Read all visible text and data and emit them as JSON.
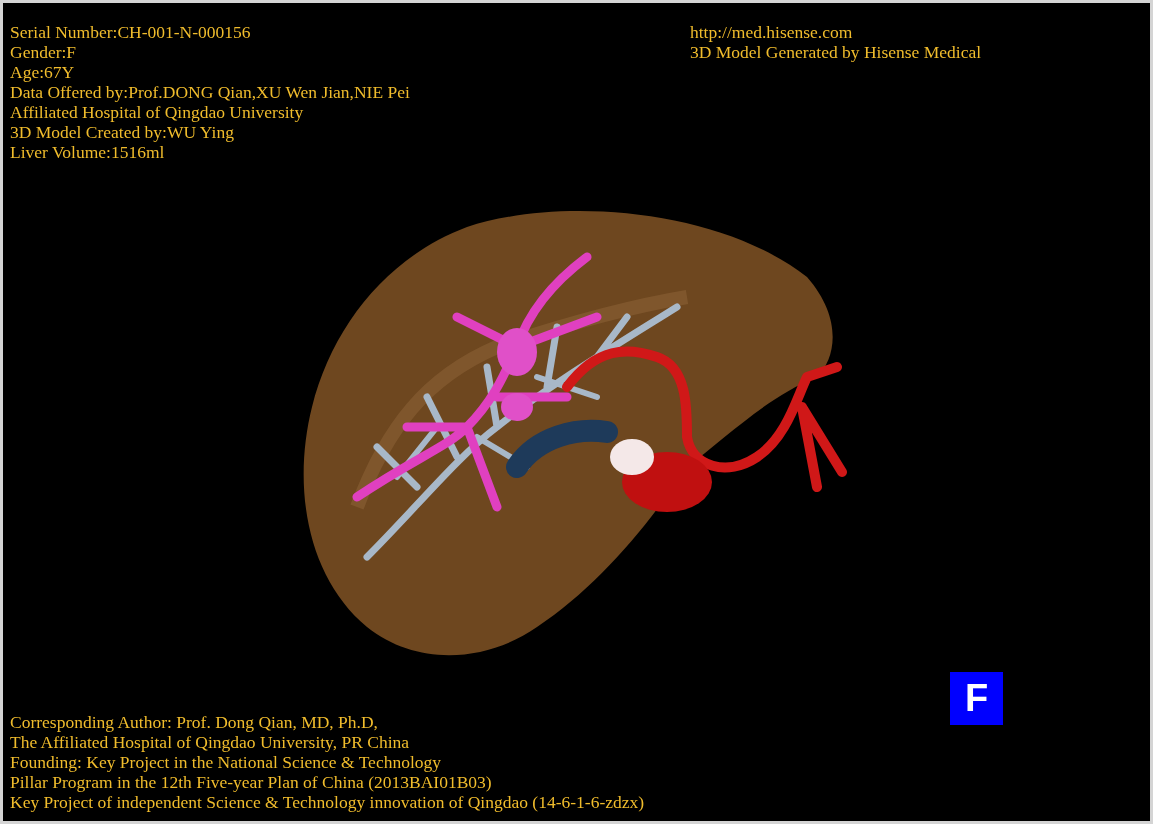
{
  "header_left": {
    "lines": [
      "Serial Number:CH-001-N-000156",
      "Gender:F",
      "Age:67Y",
      "Data Offered by:Prof.DONG Qian,XU Wen Jian,NIE Pei",
      "Affiliated Hospital of Qingdao University",
      "3D Model Created by:WU Ying",
      "Liver Volume:1516ml"
    ]
  },
  "header_right": {
    "lines": [
      "http://med.hisense.com",
      "3D Model Generated by Hisense Medical"
    ]
  },
  "orientation": {
    "label": "F"
  },
  "footer": {
    "lines": [
      "Corresponding Author: Prof. Dong Qian, MD, Ph.D,",
      "The Affiliated Hospital of Qingdao University, PR China",
      "Founding: Key Project in the National Science & Technology",
      "Pillar Program in the 12th Five-year Plan of China (2013BAI01B03)",
      "Key Project of independent Science & Technology innovation of Qingdao (14-6-1-6-zdzx)"
    ]
  }
}
